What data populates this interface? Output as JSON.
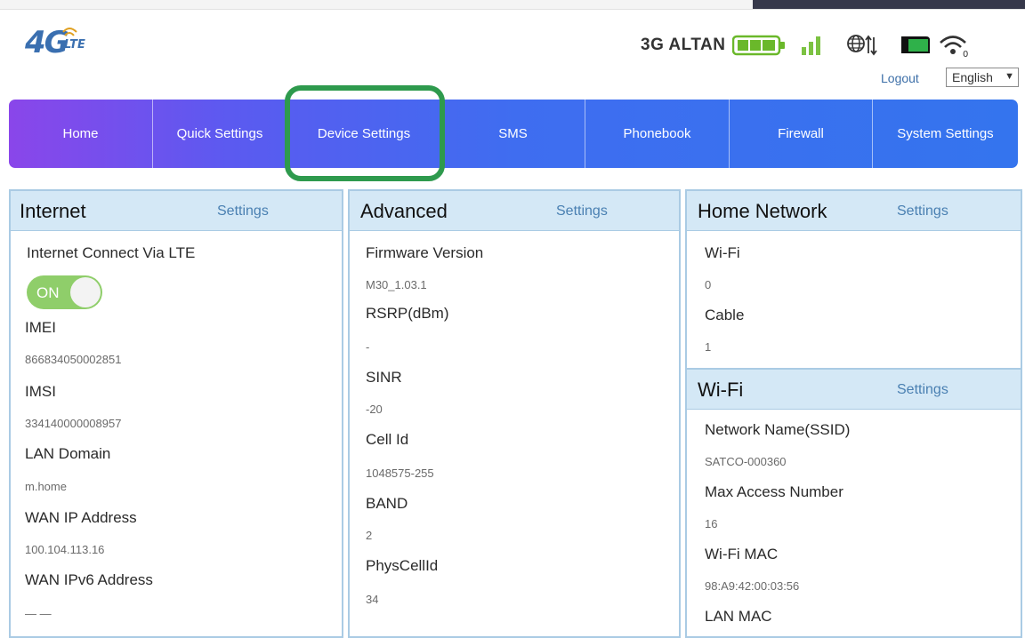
{
  "app": {
    "logo_text": "4G",
    "logo_sub": "LTE"
  },
  "status": {
    "network": "3G ALTAN"
  },
  "header": {
    "logout": "Logout",
    "language": "English"
  },
  "nav": {
    "items": [
      "Home",
      "Quick Settings",
      "Device Settings",
      "SMS",
      "Phonebook",
      "Firewall",
      "System Settings"
    ]
  },
  "internet": {
    "title": "Internet",
    "settings": "Settings",
    "connect_label": "Internet Connect Via LTE",
    "toggle": "ON",
    "imei_label": "IMEI",
    "imei": "866834050002851",
    "imsi_label": "IMSI",
    "imsi": "334140000008957",
    "lan_domain_label": "LAN Domain",
    "lan_domain": "m.home",
    "wan_ip_label": "WAN IP Address",
    "wan_ip": "100.104.113.16",
    "wan_ipv6_label": "WAN IPv6 Address",
    "wan_ipv6": "— —"
  },
  "advanced": {
    "title": "Advanced",
    "settings": "Settings",
    "firmware_label": "Firmware Version",
    "firmware": "M30_1.03.1",
    "rsrp_label": "RSRP(dBm)",
    "rsrp": "-",
    "sinr_label": "SINR",
    "sinr": "-20",
    "cellid_label": "Cell Id",
    "cellid": "1048575-255",
    "band_label": "BAND",
    "band": "2",
    "physcell_label": "PhysCellId",
    "physcell": "34"
  },
  "home_network": {
    "title": "Home Network",
    "settings": "Settings",
    "wifi_label": "Wi-Fi",
    "wifi": "0",
    "cable_label": "Cable",
    "cable": "1"
  },
  "wifi": {
    "title": "Wi-Fi",
    "settings": "Settings",
    "ssid_label": "Network Name(SSID)",
    "ssid": "SATCO-000360",
    "max_label": "Max Access Number",
    "max": "16",
    "mac_label": "Wi-Fi MAC",
    "mac": "98:A9:42:00:03:56",
    "lan_mac_label": "LAN MAC"
  },
  "colors": {
    "nav_gradient_start": "#8a46ea",
    "nav_gradient_end": "#3474ee",
    "highlight": "#2e9a4d",
    "panel_header": "#d4e8f6",
    "toggle_on": "#8fce6a"
  }
}
